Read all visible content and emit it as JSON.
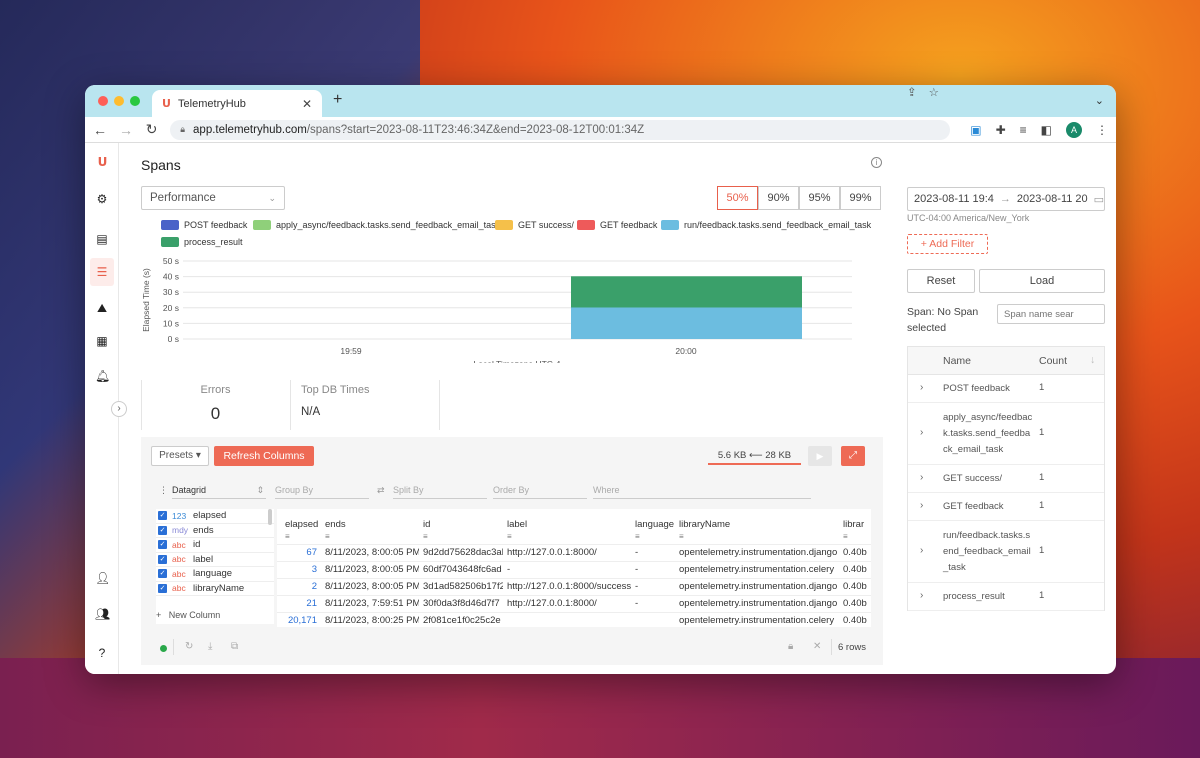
{
  "browser": {
    "tab_title": "TelemetryHub",
    "url_host": "app.telemetryhub.com",
    "url_path": "/spans?start=2023-08-11T23:46:34Z&end=2023-08-12T00:01:34Z",
    "avatar_letter": "A"
  },
  "page": {
    "title": "Spans",
    "view_select": "Performance",
    "percentiles": [
      "50%",
      "90%",
      "95%",
      "99%"
    ],
    "active_percentile": "50%"
  },
  "legend": [
    {
      "label": "POST feedback",
      "color": "#4a62c8"
    },
    {
      "label": "apply_async/feedback.tasks.send_feedback_email_task",
      "color": "#8fd07a"
    },
    {
      "label": "GET success/",
      "color": "#f5c04a"
    },
    {
      "label": "GET feedback",
      "color": "#ee5a5a"
    },
    {
      "label": "run/feedback.tasks.send_feedback_email_task",
      "color": "#6cbde0"
    },
    {
      "label": "process_result",
      "color": "#3aa06a"
    }
  ],
  "chart_data": {
    "type": "bar",
    "ylabel": "Elapsed Time (s)",
    "xlabel": "Local Timezone UTC-4",
    "y_ticks": [
      "0 s",
      "10 s",
      "20 s",
      "30 s",
      "40 s",
      "50 s"
    ],
    "ylim": [
      0,
      50
    ],
    "x_ticks": [
      "19:59",
      "20:00"
    ],
    "series": [
      {
        "name": "run/feedback.tasks.send_feedback_email_task",
        "values": [
          20.2
        ],
        "color": "#6cbde0"
      },
      {
        "name": "process_result",
        "values": [
          20.0
        ],
        "color": "#3aa06a"
      }
    ],
    "stacked": true
  },
  "kpis": [
    {
      "label": "Errors",
      "value": "0"
    },
    {
      "label": "Top DB Times",
      "value": "N/A"
    }
  ],
  "grid": {
    "presets": "Presets ▾",
    "refresh": "Refresh Columns",
    "size": "5.6 KB ⟵ 28 KB",
    "datagrid": "Datagrid",
    "group_by": "Group By",
    "split_by": "Split By",
    "order_by": "Order By",
    "where": "Where",
    "new_column": "New Column",
    "rows": "6 rows",
    "columns": [
      {
        "type": "123",
        "kind": "num",
        "name": "elapsed"
      },
      {
        "type": "mdy",
        "kind": "date",
        "name": "ends"
      },
      {
        "type": "abc",
        "kind": "str",
        "name": "id"
      },
      {
        "type": "abc",
        "kind": "str",
        "name": "label"
      },
      {
        "type": "abc",
        "kind": "str",
        "name": "language"
      },
      {
        "type": "abc",
        "kind": "str",
        "name": "libraryName"
      }
    ],
    "headers": [
      "elapsed",
      "ends",
      "id",
      "label",
      "language",
      "libraryName",
      "librar"
    ],
    "rows_data": [
      [
        "67",
        "8/11/2023, 8:00:05 PM",
        "9d2dd75628dac3ab",
        "http://127.0.0.1:8000/",
        "-",
        "opentelemetry.instrumentation.django",
        "0.40b"
      ],
      [
        "3",
        "8/11/2023, 8:00:05 PM",
        "60df7043648fc6ad",
        "-",
        "-",
        "opentelemetry.instrumentation.celery",
        "0.40b"
      ],
      [
        "2",
        "8/11/2023, 8:00:05 PM",
        "3d1ad582506b17f2",
        "http://127.0.0.1:8000/success/",
        "-",
        "opentelemetry.instrumentation.django",
        "0.40b"
      ],
      [
        "21",
        "8/11/2023, 7:59:51 PM",
        "30f0da3f8d46d7f7",
        "http://127.0.0.1:8000/",
        "-",
        "opentelemetry.instrumentation.django",
        "0.40b"
      ],
      [
        "20,171",
        "8/11/2023, 8:00:25 PM",
        "2f081ce1f0c25c2e",
        "",
        "",
        "opentelemetry.instrumentation.celery",
        "0.40b"
      ]
    ]
  },
  "right": {
    "date_start": "2023-08-11 19:4",
    "date_arrow": "→",
    "date_end": "2023-08-11 20",
    "timezone": "UTC-04:00 America/New_York",
    "add_filter": "+ Add Filter",
    "reset": "Reset",
    "load": "Load",
    "span_selected": "Span: No Span selected",
    "span_search_placeholder": "Span name sear",
    "head_name": "Name",
    "head_count": "Count",
    "spans": [
      {
        "name": "POST feedback",
        "count": "1"
      },
      {
        "name": "apply_async/feedback.tasks.send_feedback_email_task",
        "count": "1"
      },
      {
        "name": "GET success/",
        "count": "1"
      },
      {
        "name": "GET feedback",
        "count": "1"
      },
      {
        "name": "run/feedback.tasks.send_feedback_email_task",
        "count": "1"
      },
      {
        "name": "process_result",
        "count": "1"
      }
    ]
  }
}
